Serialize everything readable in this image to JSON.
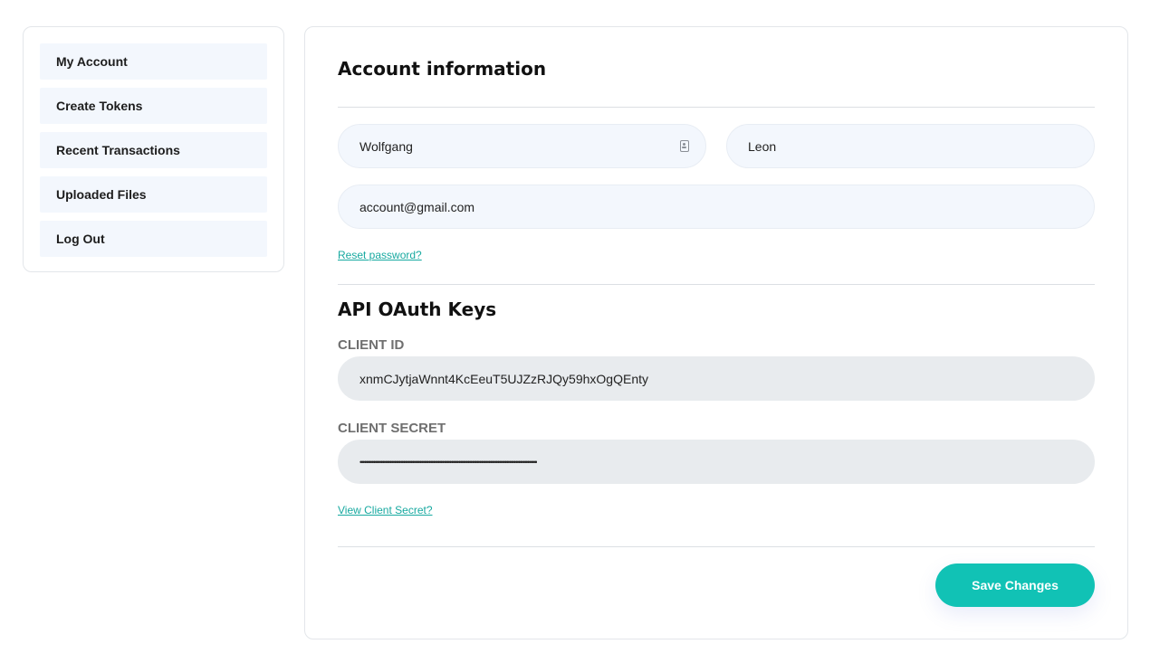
{
  "sidebar": {
    "items": [
      {
        "label": "My Account"
      },
      {
        "label": "Create Tokens"
      },
      {
        "label": "Recent Transactions"
      },
      {
        "label": "Uploaded Files"
      },
      {
        "label": "Log Out"
      }
    ]
  },
  "account": {
    "title": "Account information",
    "first_name": "Wolfgang",
    "last_name": "Leon",
    "email": "account@gmail.com",
    "reset_password_link": "Reset password?"
  },
  "api": {
    "title": "API OAuth Keys",
    "client_id_label": "CLIENT ID",
    "client_id_value": "xnmCJytjaWnnt4KcEeuT5UJZzRJQy59hxOgQEnty",
    "client_secret_label": "CLIENT SECRET",
    "client_secret_value": "•••••••••••••••••••••••••••••••••••••••••••••••••••••••••••••••••••••••••••••••••••••••••••••••••••••••••••••••••••••••",
    "view_secret_link": "View Client Secret?"
  },
  "actions": {
    "save_label": "Save Changes"
  },
  "colors": {
    "accent": "#11c2b5",
    "link": "#17a9a0",
    "field_bg": "#f3f7fd",
    "readonly_bg": "#e8ebee"
  },
  "icons": {
    "first_name_field_icon": "contact-card-icon"
  }
}
